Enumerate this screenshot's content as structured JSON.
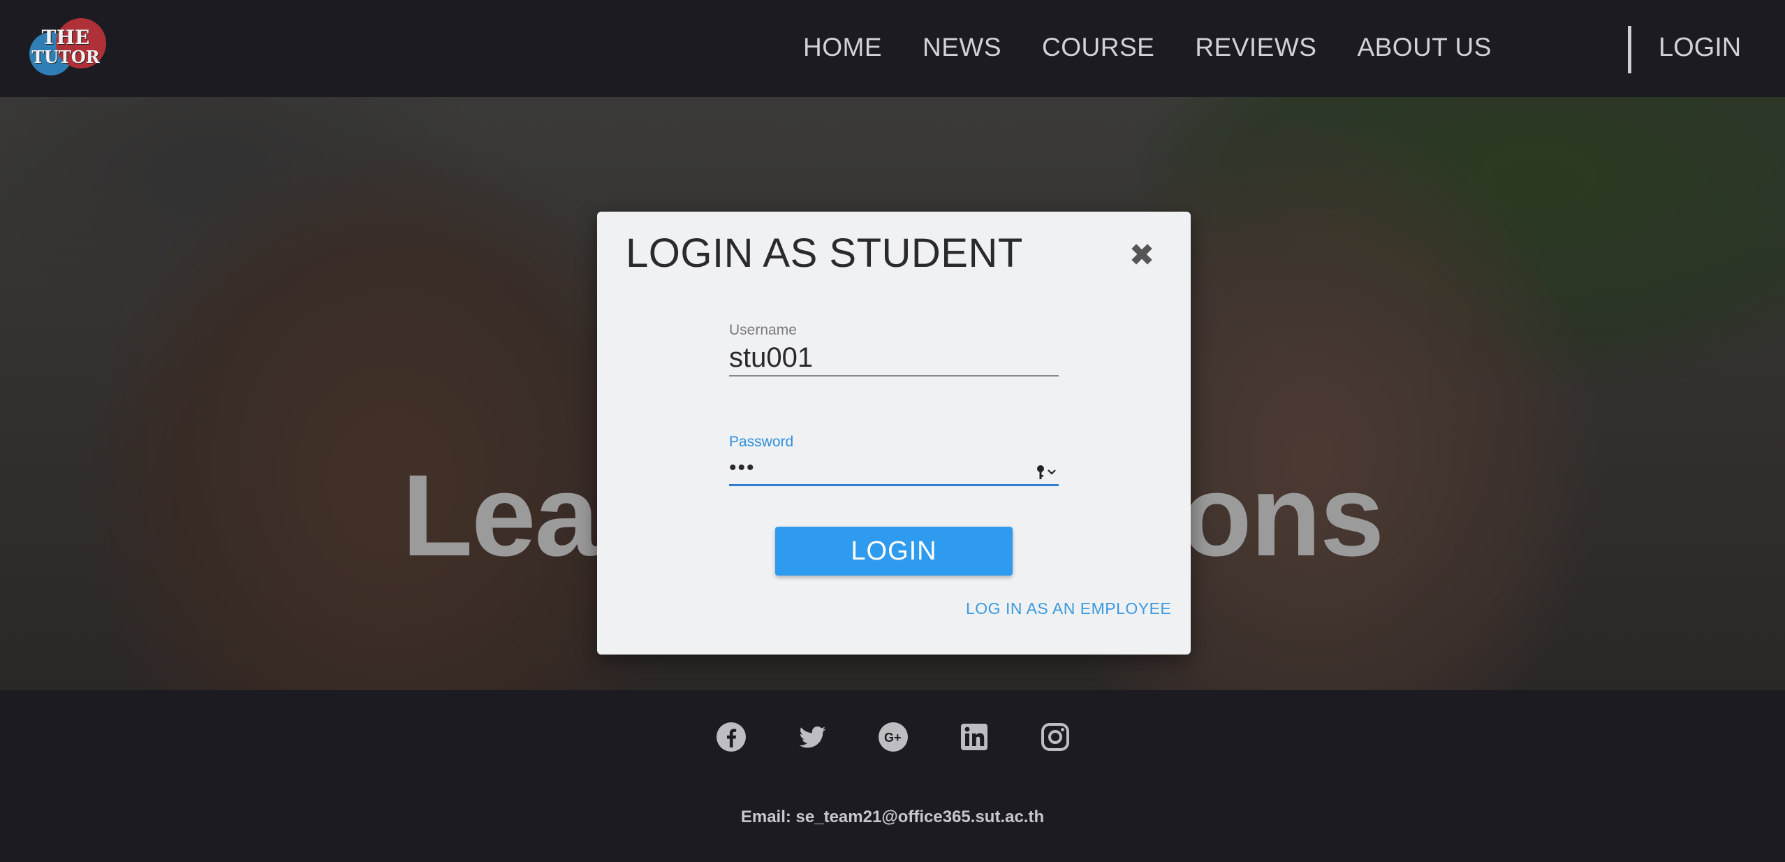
{
  "brand": {
    "line1": "THE",
    "line2": "TUTOR"
  },
  "nav": {
    "items": [
      "HOME",
      "NEWS",
      "COURSE",
      "REVIEWS",
      "ABOUT US"
    ],
    "login": "LOGIN"
  },
  "hero": {
    "title": "Leading Solutions",
    "visible_fragments": [
      "Lea",
      "ions"
    ]
  },
  "modal": {
    "title": "LOGIN AS STUDENT",
    "close_icon": "close-icon",
    "username": {
      "label": "Username",
      "value": "stu001"
    },
    "password": {
      "label": "Password",
      "value": "•••",
      "icon": "key-icon"
    },
    "login_button": "LOGIN",
    "employee_link": "LOG IN AS AN EMPLOYEE"
  },
  "footer": {
    "social_icons": [
      "facebook-icon",
      "twitter-icon",
      "google-plus-icon",
      "linkedin-icon",
      "instagram-icon"
    ],
    "email": "Email: se_team21@office365.sut.ac.th"
  },
  "colors": {
    "header_bg": "#1c1b22",
    "modal_bg": "#f0f1f3",
    "accent_blue": "#2e9bef",
    "link_blue": "#3a9ae0"
  }
}
